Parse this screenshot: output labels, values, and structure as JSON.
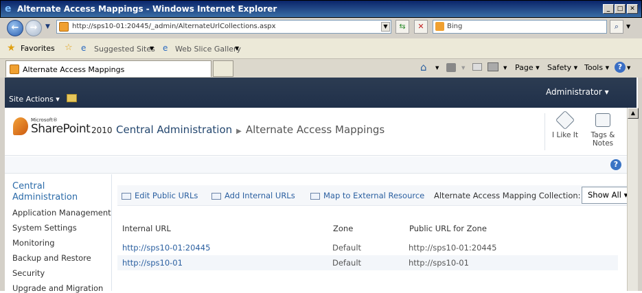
{
  "window": {
    "title": "Alternate Access Mappings - Windows Internet Explorer"
  },
  "browser": {
    "address": "http://sps10-01:20445/_admin/AlternateUrlCollections.aspx",
    "search_placeholder": "Bing",
    "favorites_label": "Favorites",
    "suggested_sites": "Suggested Sites",
    "web_slice_gallery": "Web Slice Gallery",
    "tab_title": "Alternate Access Mappings",
    "commands": {
      "page": "Page",
      "safety": "Safety",
      "tools": "Tools"
    }
  },
  "sharepoint": {
    "user": "Administrator",
    "site_actions": "Site Actions",
    "logo_microsoft": "Microsoft®",
    "logo_product": "SharePoint",
    "logo_version": "2010",
    "breadcrumb": {
      "root": "Central Administration",
      "current": "Alternate Access Mappings"
    },
    "ribbon_buttons": {
      "like": "I Like It",
      "tags_line1": "Tags &",
      "tags_line2": "Notes"
    }
  },
  "leftnav": {
    "heading_line1": "Central",
    "heading_line2": "Administration",
    "items": [
      "Application Management",
      "System Settings",
      "Monitoring",
      "Backup and Restore",
      "Security",
      "Upgrade and Migration"
    ]
  },
  "toolbar": {
    "edit_public": "Edit Public URLs",
    "add_internal": "Add Internal URLs",
    "map_external": "Map to External Resource",
    "collection_label": "Alternate Access Mapping Collection:",
    "collection_value": "Show All"
  },
  "table": {
    "headers": [
      "Internal URL",
      "Zone",
      "Public URL for Zone"
    ],
    "rows": [
      {
        "internal": "http://sps10-01:20445",
        "zone": "Default",
        "public": "http://sps10-01:20445"
      },
      {
        "internal": "http://sps10-01",
        "zone": "Default",
        "public": "http://sps10-01"
      }
    ]
  }
}
